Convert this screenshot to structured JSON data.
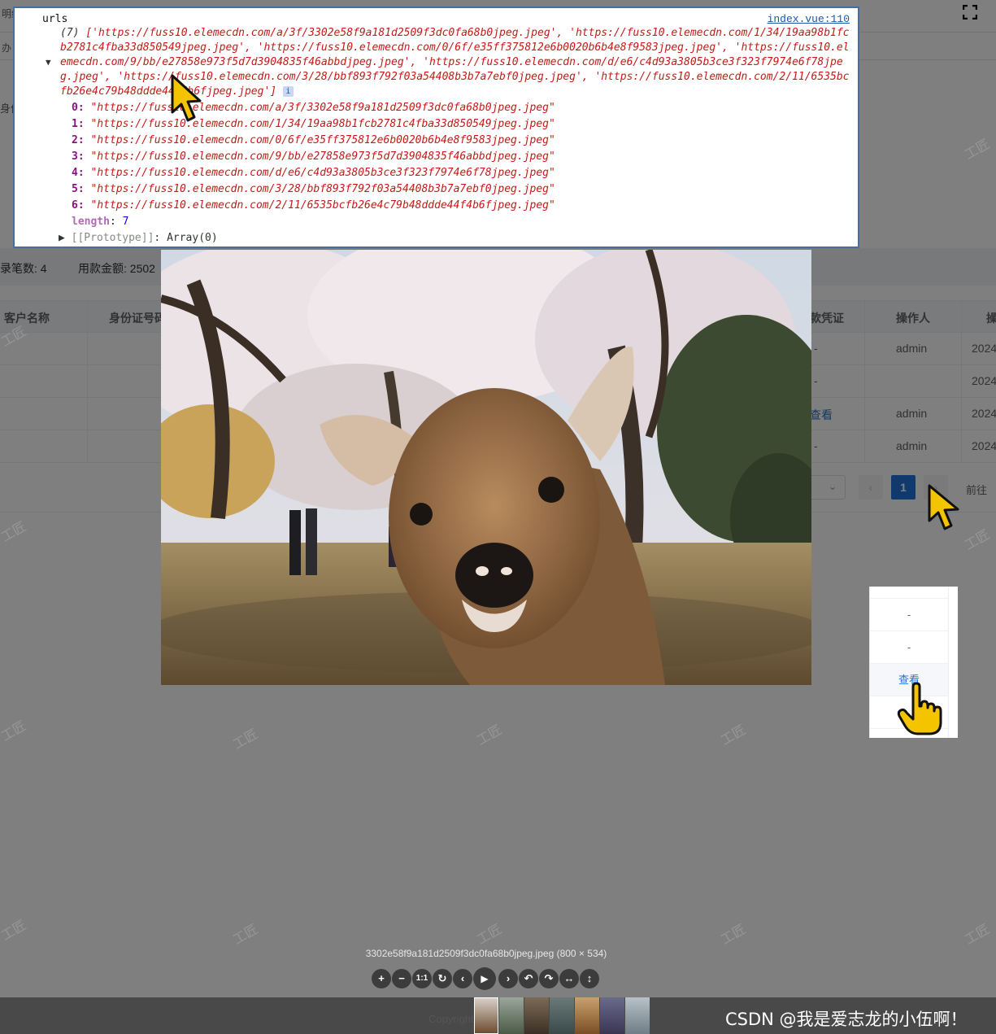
{
  "app": {
    "breadcrumb": "明细",
    "tab_label": "办",
    "filter_label": "身份",
    "summary": {
      "count_label": "录笔数: 4",
      "amount_label": "用款金额: 2502"
    },
    "table": {
      "columns": [
        "客户名称",
        "身份证号码",
        "款凭证",
        "操作人",
        "操"
      ],
      "rows": [
        {
          "voucher": "-",
          "operator": "admin",
          "time": "2024"
        },
        {
          "voucher": "-",
          "operator": "",
          "time": "2024"
        },
        {
          "voucher": "查看",
          "operator": "admin",
          "time": "2024"
        },
        {
          "voucher": "-",
          "operator": "admin",
          "time": "2024"
        }
      ]
    },
    "pagination": {
      "current_page": "1",
      "prev": "‹",
      "next": "›",
      "goto_label": "前往"
    }
  },
  "console": {
    "label": "urls",
    "source_link": "index.vue:110",
    "summary_count": "(7)",
    "summary_text": "['https://fuss10.elemecdn.com/a/3f/3302e58f9a181d2509f3dc0fa68b0jpeg.jpeg', 'https://fuss10.elemecdn.com/1/34/19aa98b1fcb2781c4fba33d850549jpeg.jpeg', 'https://fuss10.elemecdn.com/0/6f/e35ff375812e6b0020b6b4e8f9583jpeg.jpeg', 'https://fuss10.elemecdn.com/9/bb/e27858e973f5d7d3904835f46abbdjpeg.jpeg', 'https://fuss10.elemecdn.com/d/e6/c4d93a3805b3ce3f323f7974e6f78jpeg.jpeg', 'https://fuss10.elemecdn.com/3/28/bbf893f792f03a54408b3b7a7ebf0jpeg.jpeg', 'https://fuss10.elemecdn.com/2/11/6535bcfb26e4c79b48ddde44f4b6fjpeg.jpeg']",
    "info_badge": "i",
    "items": [
      {
        "key": "0:",
        "value": "\"https://fuss10.elemecdn.com/a/3f/3302e58f9a181d2509f3dc0fa68b0jpeg.jpeg\""
      },
      {
        "key": "1:",
        "value": "\"https://fuss10.elemecdn.com/1/34/19aa98b1fcb2781c4fba33d850549jpeg.jpeg\""
      },
      {
        "key": "2:",
        "value": "\"https://fuss10.elemecdn.com/0/6f/e35ff375812e6b0020b6b4e8f9583jpeg.jpeg\""
      },
      {
        "key": "3:",
        "value": "\"https://fuss10.elemecdn.com/9/bb/e27858e973f5d7d3904835f46abbdjpeg.jpeg\""
      },
      {
        "key": "4:",
        "value": "\"https://fuss10.elemecdn.com/d/e6/c4d93a3805b3ce3f323f7974e6f78jpeg.jpeg\""
      },
      {
        "key": "5:",
        "value": "\"https://fuss10.elemecdn.com/3/28/bbf893f792f03a54408b3b7a7ebf0jpeg.jpeg\""
      },
      {
        "key": "6:",
        "value": "\"https://fuss10.elemecdn.com/2/11/6535bcfb26e4c79b48ddde44f4b6fjpeg.jpeg\""
      }
    ],
    "length_key": "length",
    "length_value": "7",
    "prototype_key": "[[Prototype]]",
    "prototype_value": "Array(0)"
  },
  "viewer": {
    "caption": "3302e58f9a181d2509f3dc0fa68b0jpeg.jpeg (800 × 534)",
    "toolbar_icons": [
      "zoom-in-icon",
      "zoom-out-icon",
      "one-to-one-icon",
      "reset-icon",
      "prev-icon",
      "play-icon",
      "next-icon",
      "rotate-left-icon",
      "rotate-right-icon",
      "flip-horizontal-icon",
      "flip-vertical-icon"
    ],
    "toolbar_glyphs": [
      "+",
      "−",
      "1:1",
      "↻",
      "‹",
      "▶",
      "›",
      "↶",
      "↷",
      "↔",
      "↕"
    ],
    "copyright": "Copyright",
    "thumbnail_count": 7
  },
  "inset": {
    "cells": [
      "-",
      "-",
      "查看"
    ]
  },
  "watermark_text": "工匠",
  "csdn_watermark": "CSDN @我是爱志龙的小伍啊！",
  "colors": {
    "link": "#1e74d6",
    "string": "#c41a16",
    "key": "#881280",
    "cursor": "#f5c400"
  }
}
